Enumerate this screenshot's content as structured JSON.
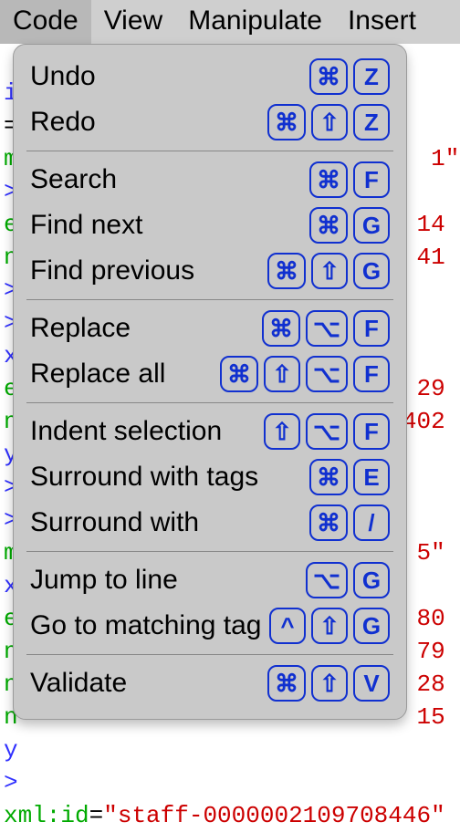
{
  "menubar": {
    "code": "Code",
    "view": "View",
    "manipulate": "Manipulate",
    "insert": "Insert"
  },
  "keys": {
    "cmd": "⌘",
    "shift": "⇧",
    "opt": "⌥",
    "ctrl": "^",
    "slash": "/",
    "Z": "Z",
    "F": "F",
    "G": "G",
    "E": "E",
    "V": "V"
  },
  "menu": {
    "undo": "Undo",
    "redo": "Redo",
    "search": "Search",
    "findNext": "Find next",
    "findPrev": "Find previous",
    "replace": "Replace",
    "replaceAll": "Replace all",
    "indentSel": "Indent selection",
    "surroundTags": "Surround with tags",
    "surroundWith": "Surround with",
    "jumpLine": "Jump to line",
    "gotoMatch": "Go to matching tag",
    "validate": "Validate"
  },
  "bg": {
    "i": "i",
    "eq": "=",
    "m": "m",
    "gt": ">",
    "e": "e",
    "n": "n",
    "close": ">",
    "x": "x",
    "y": "y",
    "one": "1\"",
    "r14": "14",
    "r41": "41",
    "r29": "29",
    "r402": "402",
    "r5": "5\"",
    "r80": "80",
    "r79": "79",
    "r28": "28",
    "r15": "15",
    "last": "xml:id=\"staff-0000002109708446\""
  }
}
